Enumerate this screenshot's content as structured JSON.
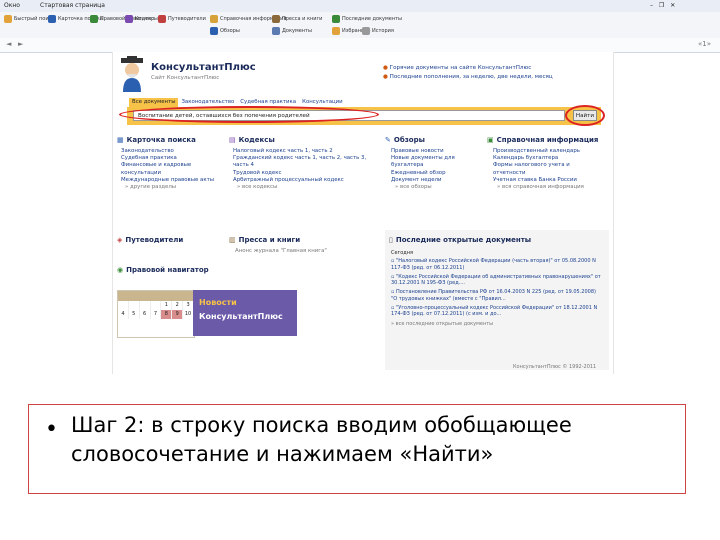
{
  "window": {
    "menu_label": "Окно",
    "tab_title": "Стартовая страница",
    "win_controls": "– ❐ ✕"
  },
  "toolbar": {
    "items": [
      {
        "label": "Быстрый поиск"
      },
      {
        "label": "Карточка поиска"
      },
      {
        "label": "Правовой навигатор"
      },
      {
        "label": "Кодексы"
      },
      {
        "label": "Путеводители"
      },
      {
        "label": "Справочная информация"
      },
      {
        "label": "Обзоры"
      },
      {
        "label": "Пресса и книги"
      },
      {
        "label": "Документы"
      },
      {
        "label": "Последние документы"
      },
      {
        "label": "Избранное"
      },
      {
        "label": "История"
      }
    ],
    "colors": {
      "accent": "#2b5fb0",
      "highlight": "#d7a23a"
    }
  },
  "nav": {
    "back": "◄",
    "forward": "►",
    "extra": "«1»"
  },
  "logo": {
    "title": "КонсультантПлюс",
    "subtitle": "Сайт КонсультантПлюс"
  },
  "top_links": [
    "Горячие документы на сайте КонсультантПлюс",
    "Последние пополнения, за неделю, две недели, месяц"
  ],
  "search": {
    "tabs": [
      "Все документы",
      "Законодательство",
      "Судебная практика",
      "Консультации"
    ],
    "value": "Воспитание детей, оставшихся без попечения родителей",
    "button": "Найти"
  },
  "sections": {
    "card": {
      "title": "Карточка поиска",
      "items": [
        "Законодательство",
        "Судебная практика",
        "Финансовые и кадровые консультации",
        "Международные правовые акты"
      ],
      "more": "другие разделы"
    },
    "codes": {
      "title": "Кодексы",
      "items": [
        "Налоговый кодекс часть 1, часть 2",
        "Гражданский кодекс часть 1, часть 2, часть 3, часть 4",
        "Трудовой кодекс",
        "Арбитражный процессуальный кодекс"
      ],
      "more": "все кодексы"
    },
    "reviews": {
      "title": "Обзоры",
      "items": [
        "Правовые новости",
        "Новые документы для бухгалтера",
        "Ежедневный обзор",
        "Документ недели"
      ],
      "more": "все обзоры"
    },
    "reference": {
      "title": "Справочная информация",
      "items": [
        "Производственный календарь",
        "Календарь бухгалтера",
        "Формы налогового учета и отчетности",
        "Учетная ставка Банка России"
      ],
      "more": "вся справочная информация"
    },
    "guides": {
      "title": "Путеводители"
    },
    "press": {
      "title": "Пресса и книги",
      "item": "Анонс журнала \"Главная книга\""
    },
    "navigator": {
      "title": "Правовой навигатор"
    },
    "news_banner": {
      "line1": "Новости",
      "line2": "КонсультантПлюс"
    },
    "last_docs": {
      "title": "Последние открытые документы",
      "today": "Сегодня",
      "items": [
        "\"Налоговый кодекс Российской Федерации (часть вторая)\" от 05.08.2000 N 117-ФЗ (ред. от 06.12.2011)",
        "\"Кодекс Российской Федерации об административных правонарушениях\" от 30.12.2001 N 195-ФЗ (ред....",
        "Постановление Правительства РФ от 16.04.2003 N 225 (ред. от 19.05.2008) \"О трудовых книжках\" (вместе с \"Правил...",
        "\"Уголовно-процессуальный кодекс Российской Федерации\" от 18.12.2001 N 174-ФЗ (ред. от 07.12.2011) (с изм. и до..."
      ],
      "more": "все последние открытые документы"
    }
  },
  "calendar": {
    "row1": [
      "",
      "",
      "",
      "",
      "",
      "",
      ""
    ],
    "row2": [
      "",
      "",
      "",
      "",
      "1",
      "2",
      "3"
    ],
    "row3": [
      "4",
      "5",
      "6",
      "7",
      "8",
      "9",
      "10"
    ]
  },
  "footer": {
    "copyright": "КонсультантПлюс © 1992-2011"
  },
  "slide": {
    "bullet": "•",
    "text": "Шаг 2: в строку поиска вводим обобщающее словосочетание и нажимаем «Найти»"
  }
}
